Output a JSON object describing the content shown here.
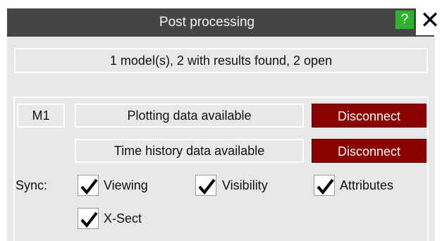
{
  "window": {
    "title": "Post processing",
    "help_label": "?",
    "close_label": "✕"
  },
  "summary": "1 model(s), 2 with results found, 2 open",
  "model": {
    "id": "M1",
    "rows": [
      {
        "status": "Plotting data available",
        "action": "Disconnect"
      },
      {
        "status": "Time history data available",
        "action": "Disconnect"
      }
    ]
  },
  "sync": {
    "label": "Sync:",
    "options": [
      {
        "label": "Viewing",
        "checked": true
      },
      {
        "label": "Visibility",
        "checked": true
      },
      {
        "label": "Attributes",
        "checked": true
      },
      {
        "label": "X-Sect",
        "checked": true
      }
    ]
  },
  "colors": {
    "titlebar": "#454545",
    "panel": "#e8e8e8",
    "disconnect": "#8b0000",
    "help": "#2fb02f"
  }
}
